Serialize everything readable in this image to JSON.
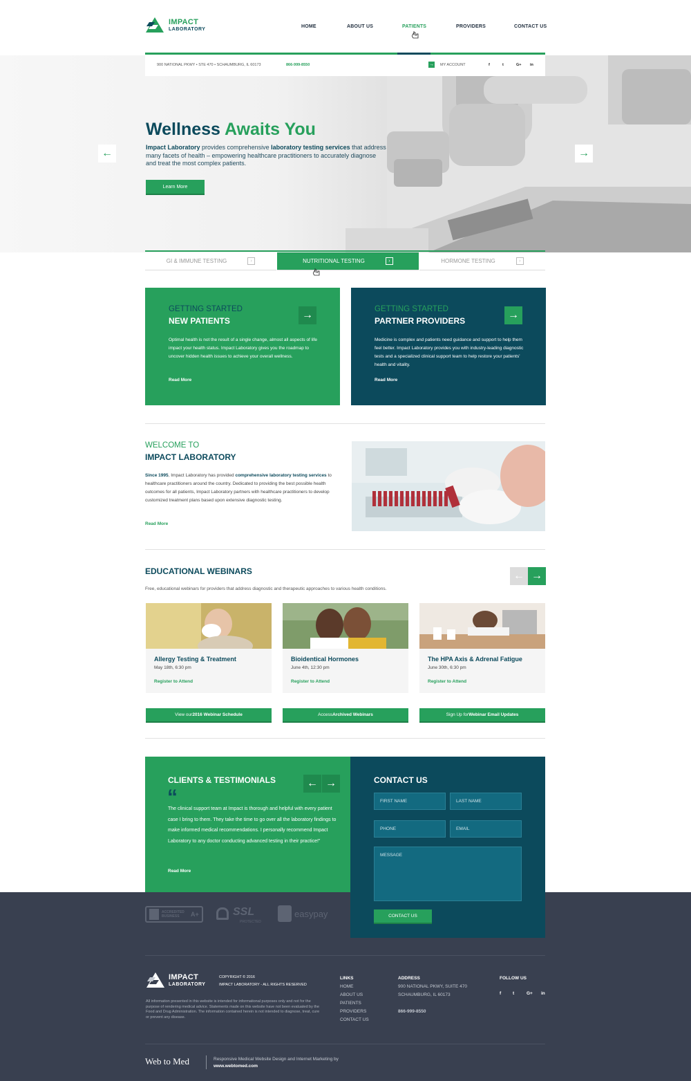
{
  "header": {
    "logo_line1": "IMPACT",
    "logo_line2": "LABORATORY",
    "nav": [
      "HOME",
      "ABOUT US",
      "PATIENTS",
      "PROVIDERS",
      "CONTACT US"
    ],
    "active_nav": "PATIENTS"
  },
  "infobar": {
    "address": "900 NATIONAL PKWY  •  STE 470  •  SCHAUMBURG, IL 60173",
    "phone": "866-999-8550",
    "account": "MY ACCOUNT",
    "social": [
      "f",
      "t",
      "G+",
      "in"
    ]
  },
  "hero": {
    "title_part1": "Wellness ",
    "title_part2": "Awaits You",
    "text_bold1": "Impact Laboratory",
    "text_mid1": " provides comprehensive ",
    "text_bold2": "laboratory testing services",
    "text_rest": " that address many facets of health – empowering healthcare practitioners to accurately diagnose and treat the most complex patients.",
    "button": "Learn More",
    "prev_icon": "←",
    "next_icon": "→"
  },
  "tabs": [
    "GI & IMMUNE TESTING",
    "NUTRITIONAL TESTING",
    "HORMONE TESTING"
  ],
  "active_tab": "NUTRITIONAL TESTING",
  "cards": [
    {
      "kicker": "GETTING STARTED",
      "title": "NEW PATIENTS",
      "body": "Optimal health is not the result of a single change, almost all aspects of life impact your health status. Impact Laboratory gives you the roadmap to uncover hidden health issues to achieve your overall wellness.",
      "link": "Read More"
    },
    {
      "kicker": "GETTING STARTED",
      "title": "PARTNER PROVIDERS",
      "body": "Medicine is complex and patients need guidance and support to help them feel better. Impact Laboratory provides you with industry-leading diagnostic tests and a specialized clinical support team to help restore your patients' health and vitality.",
      "link": "Read More"
    }
  ],
  "welcome": {
    "kicker": "WELCOME TO",
    "title": "IMPACT LABORATORY",
    "since": "Since 1995",
    "text_a": ", Impact Laboratory has provided ",
    "bold": "comprehensive laboratory testing services",
    "text_b": " to healthcare practitioners around the country. Dedicated to providing the best possible health outcomes for all patients, Impact Laboratory partners with healthcare practitioners to develop customized treatment plans based upon extensive diagnostic testing.",
    "link": "Read More"
  },
  "webinars": {
    "title": "EDUCATIONAL WEBINARS",
    "subtitle": "Free, educational webinars for providers that address diagnostic and therapeutic approaches to various health conditions.",
    "items": [
      {
        "title": "Allergy Testing & Treatment",
        "date": "May 18th, 6:30 pm",
        "link": "Register to Attend"
      },
      {
        "title": "Bioidentical Hormones",
        "date": "June 4th, 12:30 pm",
        "link": "Register to Attend"
      },
      {
        "title": "The HPA Axis & Adrenal Fatigue",
        "date": "June 30th, 6:30 pm",
        "link": "Register to Attend"
      }
    ],
    "buttons": [
      {
        "pre": "View our ",
        "bold": "2016 Webinar Schedule"
      },
      {
        "pre": "Access ",
        "bold": "Archived Webinars"
      },
      {
        "pre": "Sign Up for ",
        "bold": "Webinar Email Updates"
      }
    ]
  },
  "testimonials": {
    "title": "CLIENTS & TESTIMONIALS",
    "quote_mark": "“",
    "quote": "The clinical support team at Impact is thorough and helpful with every patient case I bring to them. They take the time to go over all the laboratory findings to make informed medical recommendations. I personally recommend Impact Laboratory to any doctor conducting advanced testing in their practice!\"",
    "link": "Read More"
  },
  "contact": {
    "title": "CONTACT US",
    "first_name": "FIRST NAME",
    "last_name": "LAST NAME",
    "phone": "PHONE",
    "email": "EMAIL",
    "message": "MESSAGE",
    "button": "CONTACT US"
  },
  "badges": [
    "ACCREDITED BUSINESS",
    "A+",
    "SSL",
    "PROTECTED",
    "easypay"
  ],
  "footer": {
    "logo_line1": "IMPACT",
    "logo_line2": "LABORATORY",
    "copyright": "COPYRIGHT © 2016",
    "rights": "IMPACT LABORATORY - ALL RIGHTS RESERVED",
    "disclaimer": "All information presented in this website is intended for informational purposes only and not for the purpose of rendering medical advice. Statements made on this website have not been evaluated by the Food and Drug Administration. The information contained herein is not intended to diagnose, treat, cure or prevent any disease.",
    "links_title": "LINKS",
    "links": [
      "HOME",
      "ABOUT US",
      "PATIENTS",
      "PROVIDERS",
      "CONTACT US"
    ],
    "address_title": "ADDRESS",
    "address1": "900 NATIONAL PKWY, SUITE 470",
    "address2": "SCHAUMBURG, IL 60173",
    "phone": "866-999-8550",
    "follow_title": "FOLLOW US",
    "social": [
      "f",
      "t",
      "G+",
      "in"
    ],
    "credit_logo": "Web to Med",
    "credit_text": "Responsive Medical Website Design and Internet Marketing by",
    "credit_url": "www.webtomed.com"
  },
  "colors": {
    "green": "#27a05c",
    "teal": "#0c4a5c",
    "footer": "#394050"
  }
}
